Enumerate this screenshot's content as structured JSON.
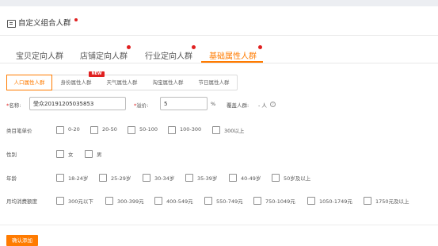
{
  "header": {
    "title": "自定义组合人群"
  },
  "tabs": [
    {
      "label": "宝贝定向人群"
    },
    {
      "label": "店铺定向人群"
    },
    {
      "label": "行业定向人群"
    },
    {
      "label": "基础属性人群"
    }
  ],
  "subtabs": [
    {
      "label": "人口属性人群"
    },
    {
      "label": "身份属性人群"
    },
    {
      "label": "天气属性人群"
    },
    {
      "label": "淘宝属性人群"
    },
    {
      "label": "节日属性人群"
    }
  ],
  "new_badge": "NEW",
  "form": {
    "name_label": "名称:",
    "name_value": "受众20191205035853",
    "bid_label": "溢价:",
    "bid_value": "5",
    "bid_unit": "%",
    "coverage_label": "覆盖人群:",
    "coverage_value": "- 人"
  },
  "filters": [
    {
      "label": "类目笔单价",
      "options": [
        "0-20",
        "20-50",
        "50-100",
        "100-300",
        "300以上"
      ]
    },
    {
      "label": "性别",
      "options": [
        "女",
        "男"
      ]
    },
    {
      "label": "年龄",
      "options": [
        "18-24岁",
        "25-29岁",
        "30-34岁",
        "35-39岁",
        "40-49岁",
        "50岁及以上"
      ]
    },
    {
      "label": "月均消费额度",
      "options": [
        "300元以下",
        "300-399元",
        "400-549元",
        "550-749元",
        "750-1049元",
        "1050-1749元",
        "1750元及以上"
      ]
    }
  ],
  "confirm_button": "确认添加",
  "colors": {
    "accent": "#ff7b00",
    "badge_red": "#e02020"
  }
}
